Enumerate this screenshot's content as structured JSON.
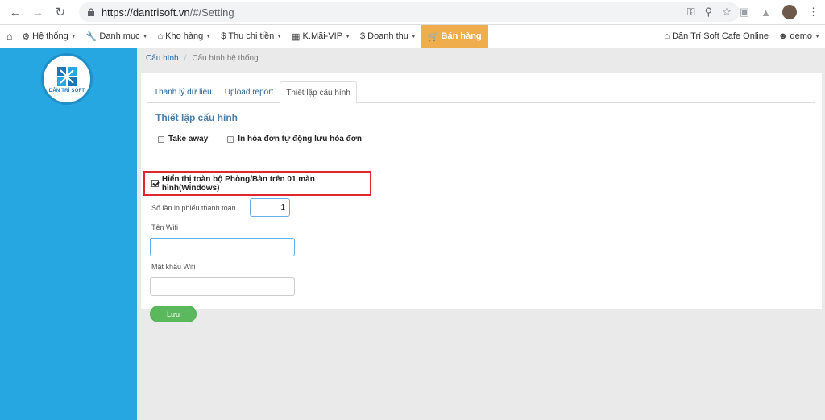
{
  "browser": {
    "url_host": "https://dantrisoft.vn",
    "url_path": "/#/Setting"
  },
  "navbar": {
    "items": [
      {
        "label": "Hệ thống",
        "icon": "gear-icon"
      },
      {
        "label": "Danh mục",
        "icon": "wrench-icon"
      },
      {
        "label": "Kho hàng",
        "icon": "home-icon"
      },
      {
        "label": "Thu chi tiền",
        "icon": "dollar-icon"
      },
      {
        "label": "K.Mãi-VIP",
        "icon": "qrcode-icon"
      },
      {
        "label": "Doanh thu",
        "icon": "dollar-icon"
      },
      {
        "label": "Bán hàng",
        "icon": "cart-icon"
      }
    ],
    "store_name": "Dân Trí Soft Cafe Online",
    "user": "demo"
  },
  "sidebar": {
    "logo_text_1": "DÂN TRÍ",
    "logo_text_2": "SOFT"
  },
  "breadcrumb": {
    "root": "Cấu hình",
    "current": "Cấu hình hệ thống"
  },
  "tabs": [
    "Thanh lý dữ liệu",
    "Upload report",
    "Thiết lập cấu hình"
  ],
  "settings": {
    "title": "Thiết lập cấu hình",
    "take_away": "Take away",
    "auto_save_print": "In hóa đơn tự động lưu hóa đơn",
    "show_all_rooms": "Hiển thị toàn bộ Phòng/Bàn trên 01 màn hình(Windows)",
    "print_count_label": "Số lần in phiếu thanh toán",
    "print_count_value": "1",
    "wifi_name_label": "Tên Wifi",
    "wifi_name_value": "",
    "wifi_password_label": "Mật khẩu Wifi",
    "wifi_password_value": "",
    "save_label": "Lưu"
  },
  "colors": {
    "sidebar": "#27a7e1",
    "active_nav": "#f0ad4e",
    "save_button": "#5cb85c",
    "highlight_border": "#e0262e"
  }
}
